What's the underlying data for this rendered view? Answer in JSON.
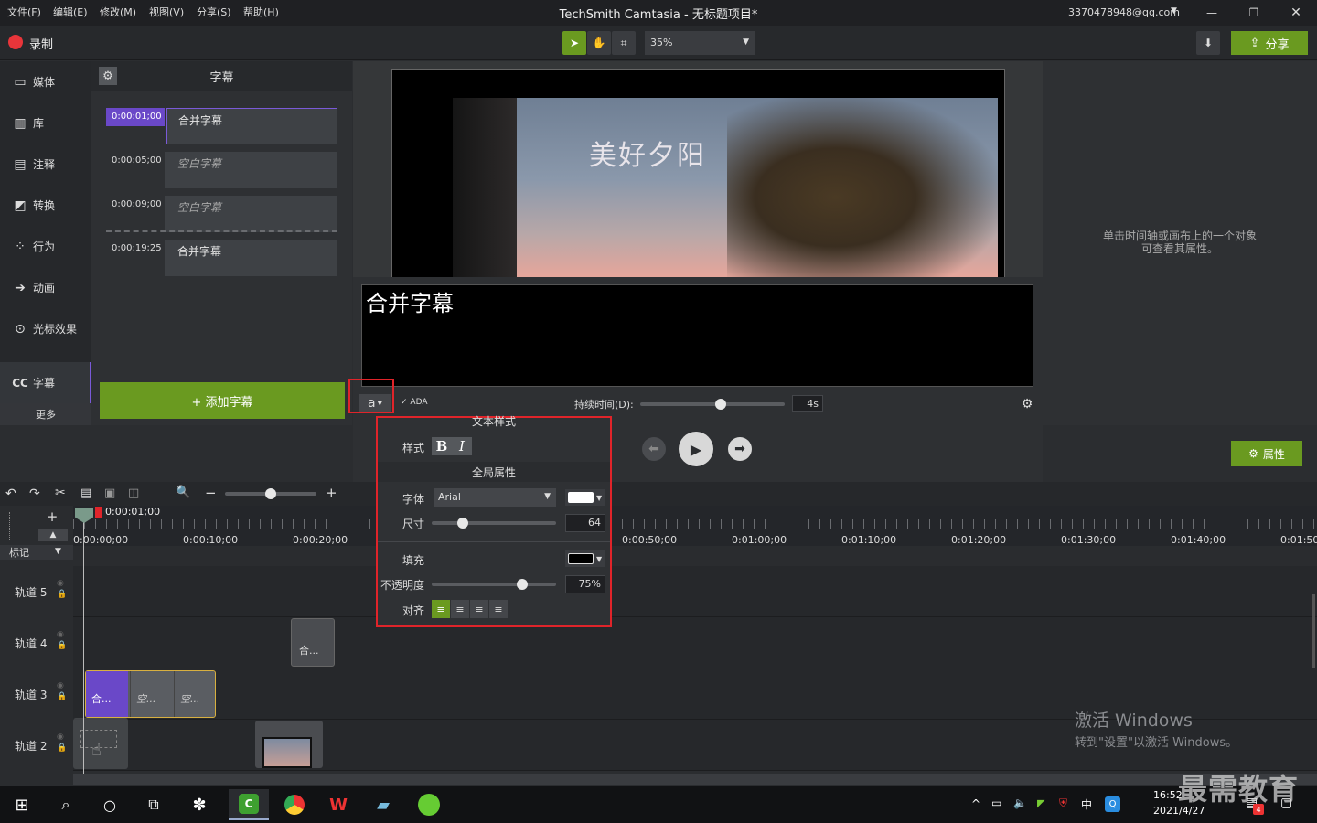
{
  "titlebar": {
    "menu": [
      "文件(F)",
      "编辑(E)",
      "修改(M)",
      "视图(V)",
      "分享(S)",
      "帮助(H)"
    ],
    "title": "TechSmith Camtasia - 无标题项目*",
    "account": "3370478948@qq.com"
  },
  "toolbar": {
    "record_label": "录制",
    "zoom": "35%",
    "share_label": "分享"
  },
  "sidebar": {
    "items": [
      {
        "label": "媒体",
        "icon": "film-icon"
      },
      {
        "label": "库",
        "icon": "library-icon"
      },
      {
        "label": "注释",
        "icon": "annotation-icon"
      },
      {
        "label": "转换",
        "icon": "transition-icon"
      },
      {
        "label": "行为",
        "icon": "behavior-icon"
      },
      {
        "label": "动画",
        "icon": "animation-icon"
      },
      {
        "label": "光标效果",
        "icon": "cursor-icon"
      },
      {
        "label": "字幕",
        "icon": "cc-icon"
      }
    ],
    "more_label": "更多"
  },
  "caption_panel": {
    "title": "字幕",
    "rows": [
      {
        "time": "0:00:01;00",
        "text": "合并字幕"
      },
      {
        "time": "0:00:05;00",
        "text": "空白字幕"
      },
      {
        "time": "0:00:09;00",
        "text": "空白字幕"
      },
      {
        "time": "0:00:19;25",
        "text": "合并字幕"
      }
    ],
    "add_label": "+ 添加字幕"
  },
  "canvas": {
    "video_title": "美好夕阳",
    "caption_text": "合并字幕",
    "style_button": "a",
    "ada_label": "ADA",
    "duration_label": "持续时间(D):",
    "duration_value": "4s"
  },
  "props": {
    "hint_line1": "单击时间轴或画布上的一个对象",
    "hint_line2": "可查看其属性。",
    "properties_label": "属性"
  },
  "popup": {
    "text_style_title": "文本样式",
    "style_label": "样式",
    "bold": "B",
    "italic": "I",
    "global_title": "全局属性",
    "font_label": "字体",
    "font_value": "Arial",
    "size_label": "尺寸",
    "size_value": "64",
    "fill_label": "填充",
    "opacity_label": "不透明度",
    "opacity_value": "75%",
    "align_label": "对齐"
  },
  "timeline": {
    "playhead_time": "0:00:01;00",
    "marker_label": "标记",
    "ruler": [
      "0:00:00;00",
      "0:00:10;00",
      "0:00:20;00",
      "0:00:50;00",
      "0:01:00;00",
      "0:01:10;00",
      "0:01:20;00",
      "0:01:30;00",
      "0:01:40;00",
      "0:01:50;"
    ],
    "tracks": [
      "轨道 5",
      "轨道 4",
      "轨道 3",
      "轨道 2"
    ],
    "clips": {
      "t4_clip": "合...",
      "t3_clip1": "合...",
      "t3_clip2": "空...",
      "t3_clip3": "空..."
    }
  },
  "watermark": {
    "line1": "激活 Windows",
    "line2": "转到\"设置\"以激活 Windows。",
    "brand": "最需教育"
  },
  "taskbar": {
    "time": "16:52",
    "date": "2021/4/27",
    "ime": "中",
    "badge": "4"
  },
  "colors": {
    "accent_green": "#6a9a20",
    "highlight_red": "#e0242a",
    "selection_purple": "#7a5ad8"
  }
}
